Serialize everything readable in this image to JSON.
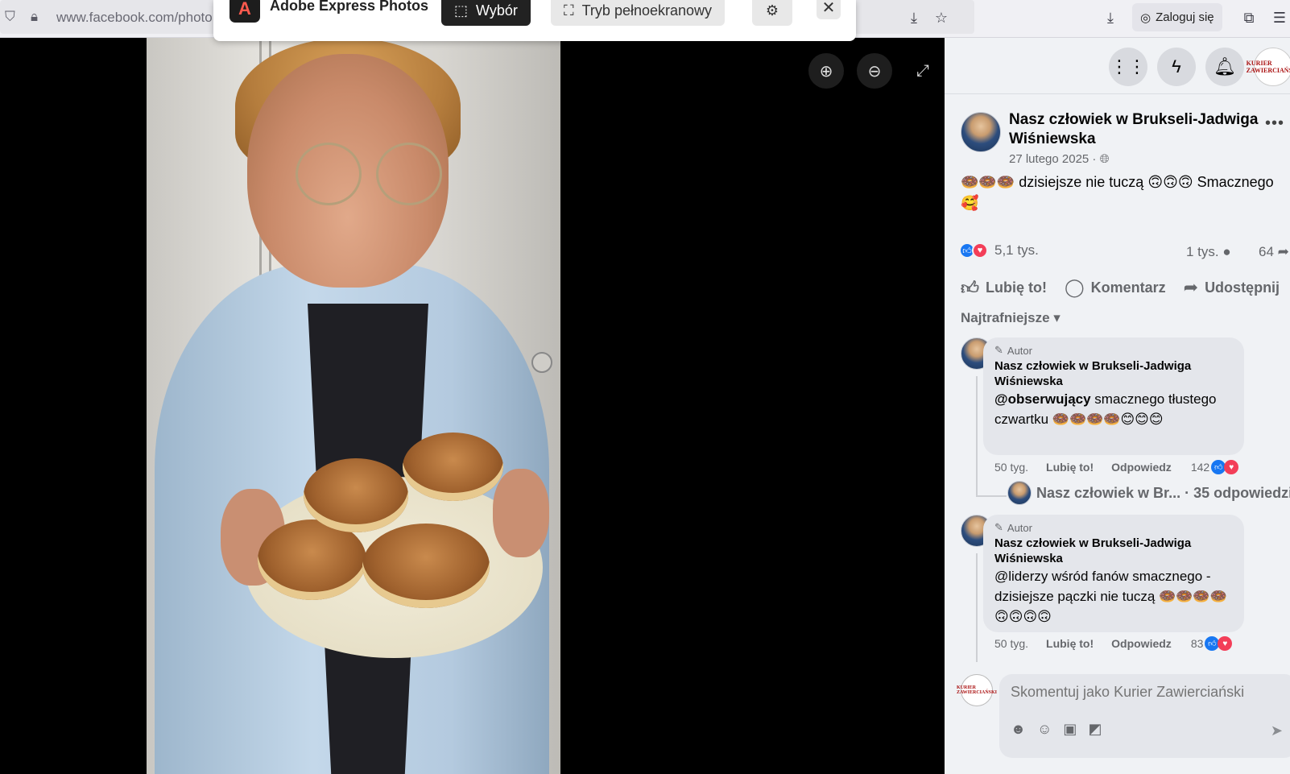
{
  "browser": {
    "url": "www.facebook.com/photo",
    "login_label": "Zaloguj się"
  },
  "adobe_popup": {
    "title": "Adobe Express Photos",
    "select_label": "Wybór",
    "fullscreen_label": "Tryb pełnoekranowy"
  },
  "post": {
    "author": "Nasz człowiek w Brukseli-Jadwiga Wiśniewska",
    "date": "27 lutego 2025 ·",
    "text": "🍩🍩🍩 dzisiejsze nie tuczą 🙃🙃🙃 Smacznego 🥰",
    "reaction_count": "5,1 tys.",
    "comment_count": "1 tys.",
    "share_count": "64",
    "actions": {
      "like": "Lubię to!",
      "comment": "Komentarz",
      "share": "Udostępnij"
    }
  },
  "comments": {
    "sort_label": "Najtrafniejsze",
    "items": [
      {
        "badge": "Autor",
        "author": "Nasz człowiek w Brukseli-Jadwiga Wiśniewska",
        "mention": "@obserwujący",
        "text": " smacznego tłustego czwartku 🍩🍩🍩🍩😊😊😊",
        "age": "50 tyg.",
        "like": "Lubię to!",
        "reply": "Odpowiedz",
        "reactions": "142"
      },
      {
        "badge": "Autor",
        "author": "Nasz człowiek w Brukseli-Jadwiga Wiśniewska",
        "text": "@liderzy wśród fanów smacznego - dzisiejsze pączki nie tuczą 🍩🍩🍩🍩🙃🙃🙃🙃",
        "age": "50 tyg.",
        "like": "Lubię to!",
        "reply": "Odpowiedz",
        "reactions": "83"
      }
    ],
    "replies_link": "Nasz człowiek w Br... · 35 odpowiedzi"
  },
  "compose": {
    "placeholder": "Skomentuj jako Kurier Zawierciański"
  },
  "page_avatar_text": "KURIER ZAWIERCIAŃSKI",
  "colors": {
    "facebook_blue": "#1877f2",
    "love_red": "#f33e58",
    "panel_bg": "#f0f2f5",
    "bubble_bg": "#e4e6eb"
  }
}
